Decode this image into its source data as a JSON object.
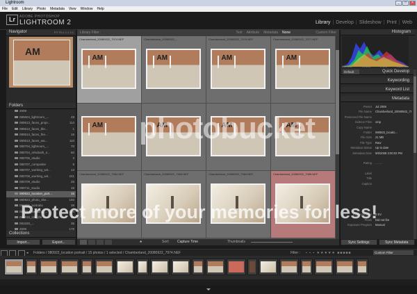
{
  "window": {
    "title": "Lightroom"
  },
  "menu": [
    "File",
    "Edit",
    "Library",
    "Photo",
    "Metadata",
    "View",
    "Window",
    "Help"
  ],
  "identity": {
    "logo": "Lr",
    "adobe": "ADOBE PHOTOSHOP",
    "product": "LIGHTROOM 2"
  },
  "modules": [
    {
      "label": "Library",
      "active": true
    },
    {
      "label": "Develop"
    },
    {
      "label": "Slideshow"
    },
    {
      "label": "Print"
    },
    {
      "label": "Web"
    }
  ],
  "left": {
    "navigator": "Navigator",
    "nav_zoom": "FIT  FILL  1:1  3:1",
    "folder_header": "Folders",
    "folders": [
      {
        "name": "2008",
        "count": "",
        "selected": false
      },
      {
        "name": "080604_lightroom_...",
        "count": "49"
      },
      {
        "name": "080613_faces_proje...",
        "count": "114"
      },
      {
        "name": "080613_faces_ble...",
        "count": "1"
      },
      {
        "name": "080613_faces_fire...",
        "count": "16"
      },
      {
        "name": "080613_faces_wa...",
        "count": "110"
      },
      {
        "name": "080704_lightroom_...",
        "count": "70"
      },
      {
        "name": "080704_rehoboth_s...",
        "count": "60"
      },
      {
        "name": "080705_studio",
        "count": "3"
      },
      {
        "name": "080707_composite",
        "count": "8"
      },
      {
        "name": "080707_working_wit...",
        "count": "13"
      },
      {
        "name": "080708_working_wit...",
        "count": "241"
      },
      {
        "name": "080709_studio",
        "count": "25"
      },
      {
        "name": "080711_studio",
        "count": "19"
      },
      {
        "name": "080922_location_port...",
        "count": "15",
        "selected": true
      },
      {
        "name": "080923_photo_ske...",
        "count": "150"
      },
      {
        "name": "081001_portraits",
        "count": "39"
      },
      {
        "name": "081014_wedding_...",
        "count": "184"
      },
      {
        "name": "081015_still_life",
        "count": "22"
      },
      {
        "name": "081020_...",
        "count": "35"
      },
      {
        "name": "2009",
        "count": "178"
      }
    ],
    "collections": "Collections",
    "import_btn": "Import...",
    "export_btn": "Export..."
  },
  "filterbar": {
    "label": "Library Filter :",
    "options": [
      {
        "label": "Text"
      },
      {
        "label": "Attribute"
      },
      {
        "label": "Metadata"
      },
      {
        "label": "None",
        "active": true
      }
    ],
    "preset": "Custom Filter"
  },
  "grid": {
    "cells": [
      {
        "name": "Chamberland_20080922_7974.NEF",
        "style": "wall",
        "selected": true
      },
      {
        "name": "Chamberland_20080922_...",
        "style": "wall"
      },
      {
        "name": "Chamberland_20080922_7976.NEF",
        "style": "wall"
      },
      {
        "name": "Chamberland_20080922_7977.NEF",
        "style": "wall"
      },
      {
        "name": "",
        "style": "wall"
      },
      {
        "name": "",
        "style": "wall"
      },
      {
        "name": "",
        "style": "wall"
      },
      {
        "name": "",
        "style": "wall"
      },
      {
        "name": "Chamberland_20080922_7982.NEF",
        "style": "bright"
      },
      {
        "name": "Chamberland_20080922_7983.NEF",
        "style": "bright"
      },
      {
        "name": "Chamberland_20080922_7984.NEF",
        "style": "bright"
      },
      {
        "name": "Chamberland_20080922_7985.NEF",
        "style": "bright",
        "highlight": true
      }
    ]
  },
  "toolbar": {
    "sort_label": "Sort:",
    "sort_value": "Capture Time",
    "thumbs_label": "Thumbnails"
  },
  "right": {
    "histogram": "Histogram",
    "hist_info": [
      "ISO 200",
      "70 mm",
      "f / 2.8",
      "1/500 sec"
    ],
    "quick_develop": "Quick Develop",
    "quick_default": "Default",
    "keywording": "Keywording",
    "keyword_list": "Keyword List",
    "metadata": "Metadata",
    "metadata_rows": [
      {
        "k": "Preset",
        "v": "Jul 2008"
      },
      {
        "k": "File Name",
        "v": "Chamberland_20080922_7974.NEF"
      },
      {
        "k": "Preserved File Name",
        "v": ""
      },
      {
        "k": "Sidecar Files",
        "v": "xmp"
      },
      {
        "k": "Copy Name",
        "v": ""
      },
      {
        "k": "Folder",
        "v": "080922_locatio..."
      },
      {
        "k": "File Size",
        "v": "21 MB"
      },
      {
        "k": "File Type",
        "v": "Raw"
      },
      {
        "k": "Metadata Status",
        "v": "Up to date"
      },
      {
        "k": "Metadata Date",
        "v": "9/6/2008 3:00:02 PM"
      },
      {
        "k": "",
        "v": ""
      },
      {
        "k": "Rating",
        "v": ". . . . ."
      },
      {
        "k": "",
        "v": ""
      },
      {
        "k": "Label",
        "v": ""
      },
      {
        "k": "Title",
        "v": ""
      },
      {
        "k": "Caption",
        "v": ""
      },
      {
        "k": "",
        "v": ""
      },
      {
        "k": "",
        "v": ""
      },
      {
        "k": "",
        "v": ""
      },
      {
        "k": "",
        "v": ""
      },
      {
        "k": "",
        "v": ""
      },
      {
        "k": "Exposure Bias",
        "v": "0 EV"
      },
      {
        "k": "Flash",
        "v": "Did not fire"
      },
      {
        "k": "Exposure Program",
        "v": "Manual"
      }
    ],
    "sync_btn": "Sync Settings",
    "sync_meta_btn": "Sync Metadata"
  },
  "filmstrip": {
    "path": "Folders / 080922_location portrait / 15 photos / 1 selected / Chamberland_20080922_7974.NEF",
    "filter_label": "Filter :",
    "filter_value": "Custom Filter",
    "thumbs": [
      "wall",
      "wall",
      "wall",
      "wall",
      "wall",
      "wall",
      "bright",
      "bright",
      "bright",
      "bright",
      "wall",
      "wall",
      "hl",
      "dark",
      "bright",
      "wall",
      "wall",
      "wall",
      "wall",
      "wall"
    ]
  },
  "watermark": {
    "line1": "photobucket",
    "line2": "Protect more of your memories for less!"
  },
  "colors": {
    "panel": "#2b2b2b",
    "grid": "#555555",
    "selected_cell": "#a0a0a0",
    "highlight_cell": "#b77a7a"
  }
}
